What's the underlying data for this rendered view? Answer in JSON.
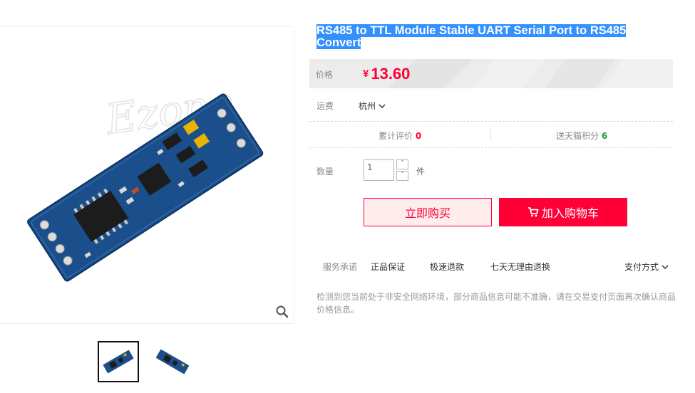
{
  "product": {
    "title_line1": "RS485 to TTL Module Stable UART Serial Port to RS485 ",
    "title_line2": "Convert",
    "image_watermark": "Ezone",
    "price_label": "价格",
    "currency": "¥",
    "price": "13.60"
  },
  "shipping": {
    "label": "运费",
    "location": "杭州"
  },
  "stats": {
    "reviews_label": "累计评价",
    "reviews_count": "0",
    "points_label": "送天猫积分",
    "points_count": "6"
  },
  "quantity": {
    "label": "数量",
    "value": "1",
    "unit": "件",
    "increase": "˄",
    "decrease": "˅"
  },
  "buttons": {
    "buy_now": "立即购买",
    "add_to_cart": "加入购物车"
  },
  "services": {
    "label": "服务承诺",
    "items": [
      "正品保证",
      "极速退款",
      "七天无理由退换"
    ],
    "payment": "支付方式"
  },
  "notice": "检测到您当前处于非安全网络环境，部分商品信息可能不准确，请在交易支付页面再次确认商品价格信息。",
  "colors": {
    "accent": "#ff0036",
    "selection": "#3390ff",
    "points_green": "#1ba133",
    "pcb_blue": "#1a4f8c"
  },
  "icons": [
    "zoom-icon",
    "chevron-down-icon",
    "cart-icon"
  ]
}
